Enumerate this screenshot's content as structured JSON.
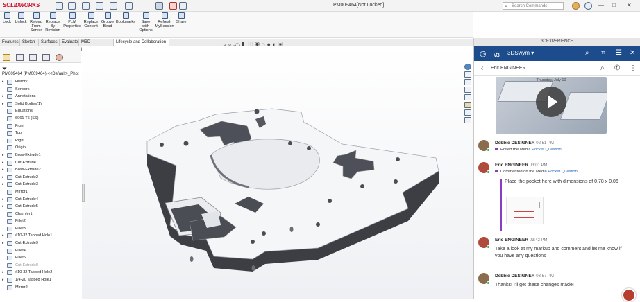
{
  "app": {
    "logo": "SOLIDWORKS",
    "doc_title": "PM009464[Not Locked]",
    "search_placeholder": "Search Commands",
    "min": "—",
    "max": "□",
    "close": "✕"
  },
  "ribbon": {
    "buttons": [
      {
        "label": "Lock",
        "icon": "lock-icon"
      },
      {
        "label": "Unlock",
        "icon": "unlock-icon"
      },
      {
        "label": "Reload From Server",
        "icon": "reload-icon"
      },
      {
        "label": "Replace By Revision",
        "icon": "replace-icon"
      },
      {
        "label": "PLM Properties",
        "icon": "properties-icon"
      },
      {
        "label": "Replace Content",
        "icon": "replace-content-icon"
      },
      {
        "label": "Groove Bead",
        "icon": "groove-icon"
      },
      {
        "label": "Bookmarks",
        "icon": "bookmark-icon"
      },
      {
        "label": "Save with Options",
        "icon": "save-icon"
      },
      {
        "label": "Refresh MySession",
        "icon": "refresh-icon"
      },
      {
        "label": "Share",
        "icon": "share-icon"
      }
    ]
  },
  "tabs": [
    "Features",
    "Sketch",
    "Surfaces",
    "Evaluate",
    "MBD Dimensions",
    "Lifecycle and Collaboration"
  ],
  "active_tab": 5,
  "tree": {
    "root": "PM009464 (PM009464) <<Default>_Phot",
    "items": [
      {
        "label": "History",
        "exp": true
      },
      {
        "label": "Sensors",
        "exp": false
      },
      {
        "label": "Annotations",
        "exp": true
      },
      {
        "label": "Solid Bodies(1)",
        "exp": true
      },
      {
        "label": "Equations",
        "exp": false
      },
      {
        "label": "6061-T6 (SS)",
        "exp": false
      },
      {
        "label": "Front",
        "exp": false
      },
      {
        "label": "Top",
        "exp": false
      },
      {
        "label": "Right",
        "exp": false
      },
      {
        "label": "Origin",
        "exp": false
      },
      {
        "label": "Boss-Extrude1",
        "exp": true
      },
      {
        "label": "Cut-Extrude1",
        "exp": true
      },
      {
        "label": "Boss-Extrude2",
        "exp": true
      },
      {
        "label": "Cut-Extrude2",
        "exp": true
      },
      {
        "label": "Cut-Extrude3",
        "exp": true
      },
      {
        "label": "Mirror1",
        "exp": false
      },
      {
        "label": "Cut-Extrude4",
        "exp": true
      },
      {
        "label": "Cut-Extrude5",
        "exp": true
      },
      {
        "label": "Chamfer1",
        "exp": false
      },
      {
        "label": "Fillet2",
        "exp": false
      },
      {
        "label": "Fillet3",
        "exp": false
      },
      {
        "label": "#10-32 Tapped Hole1",
        "exp": true
      },
      {
        "label": "Cut-Extrude9",
        "exp": true
      },
      {
        "label": "Fillet4",
        "exp": false
      },
      {
        "label": "Fillet5",
        "exp": false
      },
      {
        "label": "Cut-Extrude8",
        "exp": false,
        "sup": true
      },
      {
        "label": "#10-32 Tapped Hole2",
        "exp": true
      },
      {
        "label": "1/4-20 Tapped Hole1",
        "exp": true
      },
      {
        "label": "Mirror2",
        "exp": false
      }
    ]
  },
  "panel": {
    "title": "3DEXPERIENCE",
    "app_name": "3DSwym ▾",
    "user": "Eric ENGINEER",
    "media_date": "Thursday, July 10",
    "messages": [
      {
        "author": "Debbie DESIGNER",
        "time": "02:51 PM",
        "action": "Edited the Media",
        "link": "Pocket Question"
      },
      {
        "author": "Eric ENGINEER",
        "time": "03:01 PM",
        "action": "Commented on the Media",
        "link": "Pocket Question",
        "quote": "Place the pocket here with dimensions of 0.78 x 0.06"
      },
      {
        "author": "Eric ENGINEER",
        "time": "03:42 PM",
        "text": "Take a look at my markup and comment and let me know if you have any questions"
      },
      {
        "author": "Debbie DESIGNER",
        "time": "03:57 PM",
        "text": "Thanks! I'll get these changes made!"
      }
    ]
  }
}
